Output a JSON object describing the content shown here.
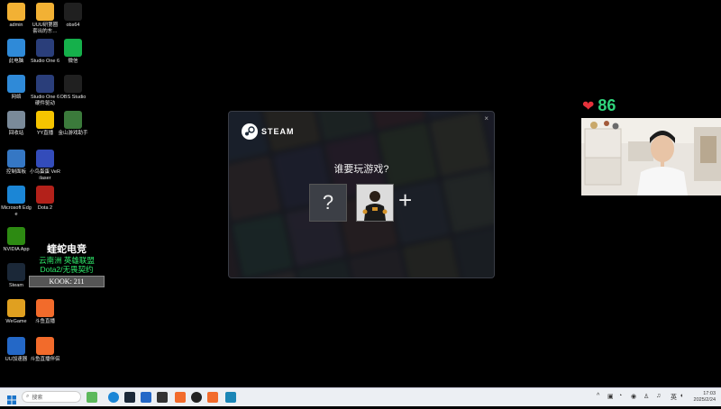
{
  "desktop_icons": [
    {
      "label": "admin",
      "icon": "folder-icon",
      "color": "#f2b134"
    },
    {
      "label": "UUU研第圈 套出的东…",
      "icon": "folder-icon",
      "color": "#f2b134"
    },
    {
      "label": "obs64",
      "icon": "obs-icon",
      "color": "#202020"
    },
    {
      "label": "此电脑",
      "icon": "computer-icon",
      "color": "#2f8ad8"
    },
    {
      "label": "Studio One 6",
      "icon": "studio-one-icon",
      "color": "#2a3e7a"
    },
    {
      "label": "微信",
      "icon": "wechat-icon",
      "color": "#15b04b"
    },
    {
      "label": "网络",
      "icon": "network-icon",
      "color": "#2f8ad8"
    },
    {
      "label": "Studio One 6 硬件驱动",
      "icon": "studio-one-icon",
      "color": "#2a3e7a"
    },
    {
      "label": "OBS Studio",
      "icon": "obs-icon",
      "color": "#202020"
    },
    {
      "label": "回收站",
      "icon": "recycle-bin-icon",
      "color": "#7a8a99"
    },
    {
      "label": "YY直播",
      "icon": "yy-icon",
      "color": "#f5c400"
    },
    {
      "label": "金山游戏助手",
      "icon": "game-assistant-icon",
      "color": "#3b7a3b"
    },
    {
      "label": "控制面板",
      "icon": "control-panel-icon",
      "color": "#3577c4"
    },
    {
      "label": "小鸟蛋蛋 VeRilaser",
      "icon": "vr-icon",
      "color": "#334cba"
    },
    {
      "label": "Microsoft Edge",
      "icon": "edge-icon",
      "color": "#1b86d6"
    },
    {
      "label": "Dota 2",
      "icon": "dota-icon",
      "color": "#b3211a"
    },
    {
      "label": "NVIDIA App",
      "icon": "nvidia-icon",
      "color": "#2d8a12"
    },
    {
      "label": "Steam",
      "icon": "steam-icon",
      "color": "#1b2838"
    },
    {
      "label": "WeGame",
      "icon": "wegame-icon",
      "color": "#e0a020"
    },
    {
      "label": "斗鱼直播",
      "icon": "douyu-icon",
      "color": "#f26b2b"
    },
    {
      "label": "UU加速器",
      "icon": "uu-accelerator-icon",
      "color": "#2468c7"
    },
    {
      "label": "斗鱼直播伴侣",
      "icon": "douyu-companion-icon",
      "color": "#f26b2b"
    }
  ],
  "steam_dialog": {
    "brand": "STEAM",
    "title": "谁要玩游戏?",
    "unknown_profile": "?",
    "add_profile": "+",
    "close": "×"
  },
  "stream_overlay": {
    "brand": "蝰蛇电竞",
    "line1": "云南洲 英雄联盟",
    "line2": "Dota2/无畏契约",
    "kook": "KOOK: 211"
  },
  "likes": {
    "count": "86"
  },
  "taskbar": {
    "search_placeholder": "搜索",
    "tray_lang": "英",
    "clock_time": "17:03",
    "clock_date": "2025/2/24"
  }
}
